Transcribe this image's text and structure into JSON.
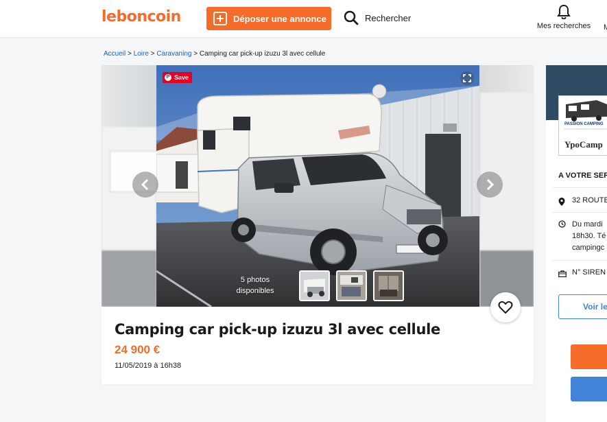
{
  "header": {
    "logo": "leboncoin",
    "post_ad_label": "Déposer une annonce",
    "search_label": "Rechercher",
    "my_searches_label": "Mes recherches",
    "edge_label": "M"
  },
  "breadcrumb": {
    "items": [
      "Accueil",
      "Loire",
      "Caravaning"
    ],
    "separator": " > ",
    "current": "Camping car pick-up izuzu 3l avec cellule"
  },
  "gallery": {
    "save_label": "Save",
    "photo_count_label": "5 photos disponibles",
    "thumbnails": 3
  },
  "listing": {
    "title": "Camping car pick-up izuzu 3l avec cellule",
    "price": "24 900 €",
    "date": "11/05/2019 à 16h38"
  },
  "seller": {
    "logo_text_1": "PASSION CAMPING",
    "logo_text_2": "YpoCamp",
    "heading": "A VOTRE SER",
    "address": "32 ROUTE",
    "hours_lines": [
      "Du mardi",
      "18h30. Té",
      "campingc"
    ],
    "siren": "N° SIREN",
    "view_button": "Voir le"
  },
  "colors": {
    "brand_orange": "#f56b2a",
    "link_blue": "#1f5fa8",
    "action_blue": "#4183d7"
  }
}
